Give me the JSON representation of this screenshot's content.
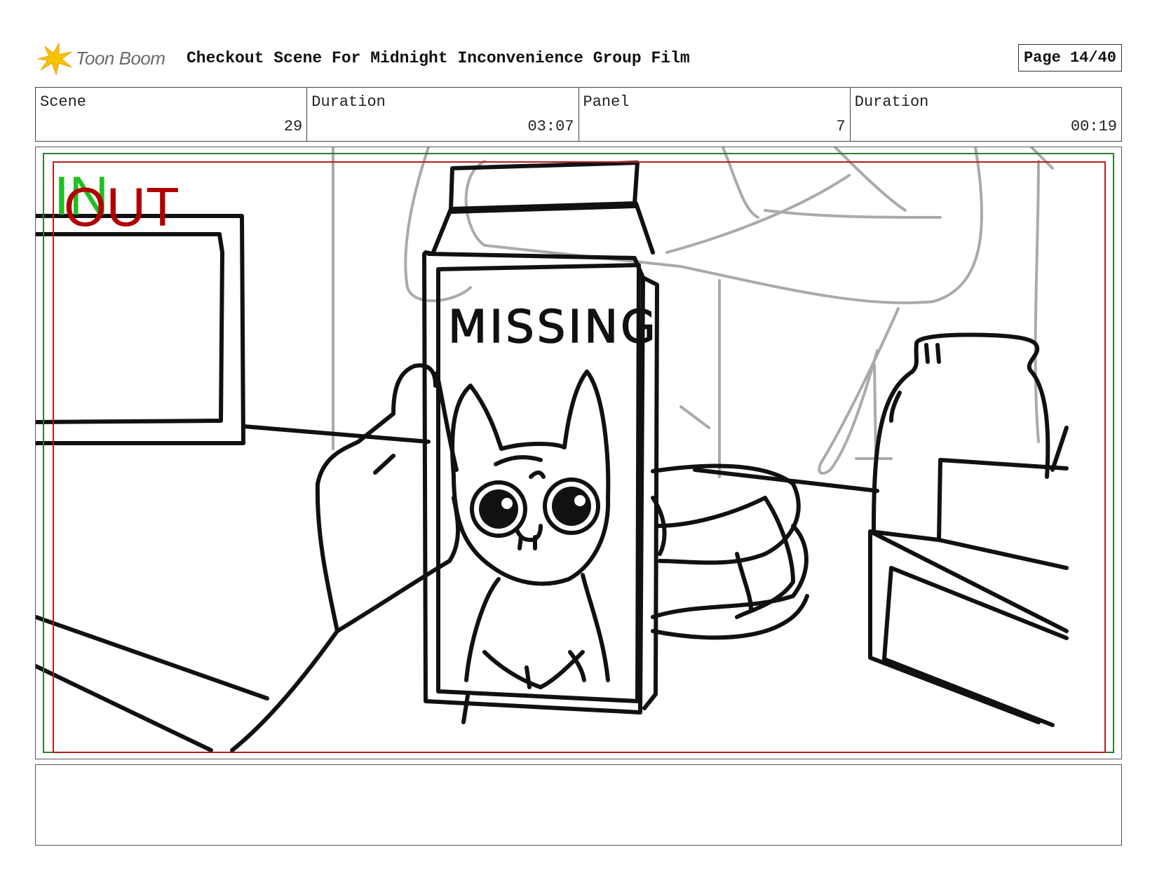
{
  "header": {
    "logo_text": "Toon Boom",
    "logo_icon": "toon-boom-burst-icon",
    "title": "Checkout Scene For Midnight Inconvenience Group Film",
    "page": "Page 14/40"
  },
  "info": {
    "scene_label": "Scene",
    "scene_value": "29",
    "scene_duration_label": "Duration",
    "scene_duration_value": "03:07",
    "panel_label": "Panel",
    "panel_value": "7",
    "panel_duration_label": "Duration",
    "panel_duration_value": "00:19"
  },
  "panel": {
    "in_marker": "IN",
    "out_marker": "OUT",
    "carton_text": "MISSING",
    "colors": {
      "in": "#1fbf1f",
      "out": "#b00000",
      "frame_green": "#2e7d32",
      "frame_red": "#b71c1c"
    }
  },
  "notes": {
    "text": ""
  }
}
